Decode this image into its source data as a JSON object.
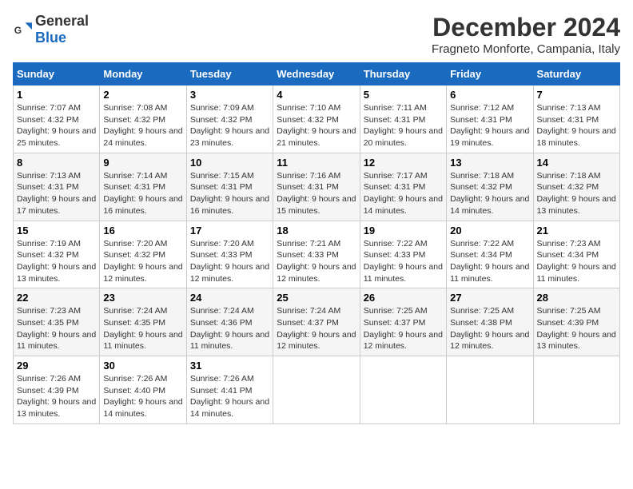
{
  "logo": {
    "text_general": "General",
    "text_blue": "Blue"
  },
  "title": "December 2024",
  "location": "Fragneto Monforte, Campania, Italy",
  "days_of_week": [
    "Sunday",
    "Monday",
    "Tuesday",
    "Wednesday",
    "Thursday",
    "Friday",
    "Saturday"
  ],
  "weeks": [
    [
      {
        "day": "1",
        "sunrise": "7:07 AM",
        "sunset": "4:32 PM",
        "daylight": "9 hours and 25 minutes."
      },
      {
        "day": "2",
        "sunrise": "7:08 AM",
        "sunset": "4:32 PM",
        "daylight": "9 hours and 24 minutes."
      },
      {
        "day": "3",
        "sunrise": "7:09 AM",
        "sunset": "4:32 PM",
        "daylight": "9 hours and 23 minutes."
      },
      {
        "day": "4",
        "sunrise": "7:10 AM",
        "sunset": "4:32 PM",
        "daylight": "9 hours and 21 minutes."
      },
      {
        "day": "5",
        "sunrise": "7:11 AM",
        "sunset": "4:31 PM",
        "daylight": "9 hours and 20 minutes."
      },
      {
        "day": "6",
        "sunrise": "7:12 AM",
        "sunset": "4:31 PM",
        "daylight": "9 hours and 19 minutes."
      },
      {
        "day": "7",
        "sunrise": "7:13 AM",
        "sunset": "4:31 PM",
        "daylight": "9 hours and 18 minutes."
      }
    ],
    [
      {
        "day": "8",
        "sunrise": "7:13 AM",
        "sunset": "4:31 PM",
        "daylight": "9 hours and 17 minutes."
      },
      {
        "day": "9",
        "sunrise": "7:14 AM",
        "sunset": "4:31 PM",
        "daylight": "9 hours and 16 minutes."
      },
      {
        "day": "10",
        "sunrise": "7:15 AM",
        "sunset": "4:31 PM",
        "daylight": "9 hours and 16 minutes."
      },
      {
        "day": "11",
        "sunrise": "7:16 AM",
        "sunset": "4:31 PM",
        "daylight": "9 hours and 15 minutes."
      },
      {
        "day": "12",
        "sunrise": "7:17 AM",
        "sunset": "4:31 PM",
        "daylight": "9 hours and 14 minutes."
      },
      {
        "day": "13",
        "sunrise": "7:18 AM",
        "sunset": "4:32 PM",
        "daylight": "9 hours and 14 minutes."
      },
      {
        "day": "14",
        "sunrise": "7:18 AM",
        "sunset": "4:32 PM",
        "daylight": "9 hours and 13 minutes."
      }
    ],
    [
      {
        "day": "15",
        "sunrise": "7:19 AM",
        "sunset": "4:32 PM",
        "daylight": "9 hours and 13 minutes."
      },
      {
        "day": "16",
        "sunrise": "7:20 AM",
        "sunset": "4:32 PM",
        "daylight": "9 hours and 12 minutes."
      },
      {
        "day": "17",
        "sunrise": "7:20 AM",
        "sunset": "4:33 PM",
        "daylight": "9 hours and 12 minutes."
      },
      {
        "day": "18",
        "sunrise": "7:21 AM",
        "sunset": "4:33 PM",
        "daylight": "9 hours and 12 minutes."
      },
      {
        "day": "19",
        "sunrise": "7:22 AM",
        "sunset": "4:33 PM",
        "daylight": "9 hours and 11 minutes."
      },
      {
        "day": "20",
        "sunrise": "7:22 AM",
        "sunset": "4:34 PM",
        "daylight": "9 hours and 11 minutes."
      },
      {
        "day": "21",
        "sunrise": "7:23 AM",
        "sunset": "4:34 PM",
        "daylight": "9 hours and 11 minutes."
      }
    ],
    [
      {
        "day": "22",
        "sunrise": "7:23 AM",
        "sunset": "4:35 PM",
        "daylight": "9 hours and 11 minutes."
      },
      {
        "day": "23",
        "sunrise": "7:24 AM",
        "sunset": "4:35 PM",
        "daylight": "9 hours and 11 minutes."
      },
      {
        "day": "24",
        "sunrise": "7:24 AM",
        "sunset": "4:36 PM",
        "daylight": "9 hours and 11 minutes."
      },
      {
        "day": "25",
        "sunrise": "7:24 AM",
        "sunset": "4:37 PM",
        "daylight": "9 hours and 12 minutes."
      },
      {
        "day": "26",
        "sunrise": "7:25 AM",
        "sunset": "4:37 PM",
        "daylight": "9 hours and 12 minutes."
      },
      {
        "day": "27",
        "sunrise": "7:25 AM",
        "sunset": "4:38 PM",
        "daylight": "9 hours and 12 minutes."
      },
      {
        "day": "28",
        "sunrise": "7:25 AM",
        "sunset": "4:39 PM",
        "daylight": "9 hours and 13 minutes."
      }
    ],
    [
      {
        "day": "29",
        "sunrise": "7:26 AM",
        "sunset": "4:39 PM",
        "daylight": "9 hours and 13 minutes."
      },
      {
        "day": "30",
        "sunrise": "7:26 AM",
        "sunset": "4:40 PM",
        "daylight": "9 hours and 14 minutes."
      },
      {
        "day": "31",
        "sunrise": "7:26 AM",
        "sunset": "4:41 PM",
        "daylight": "9 hours and 14 minutes."
      },
      null,
      null,
      null,
      null
    ]
  ],
  "labels": {
    "sunrise": "Sunrise:",
    "sunset": "Sunset:",
    "daylight": "Daylight:"
  }
}
